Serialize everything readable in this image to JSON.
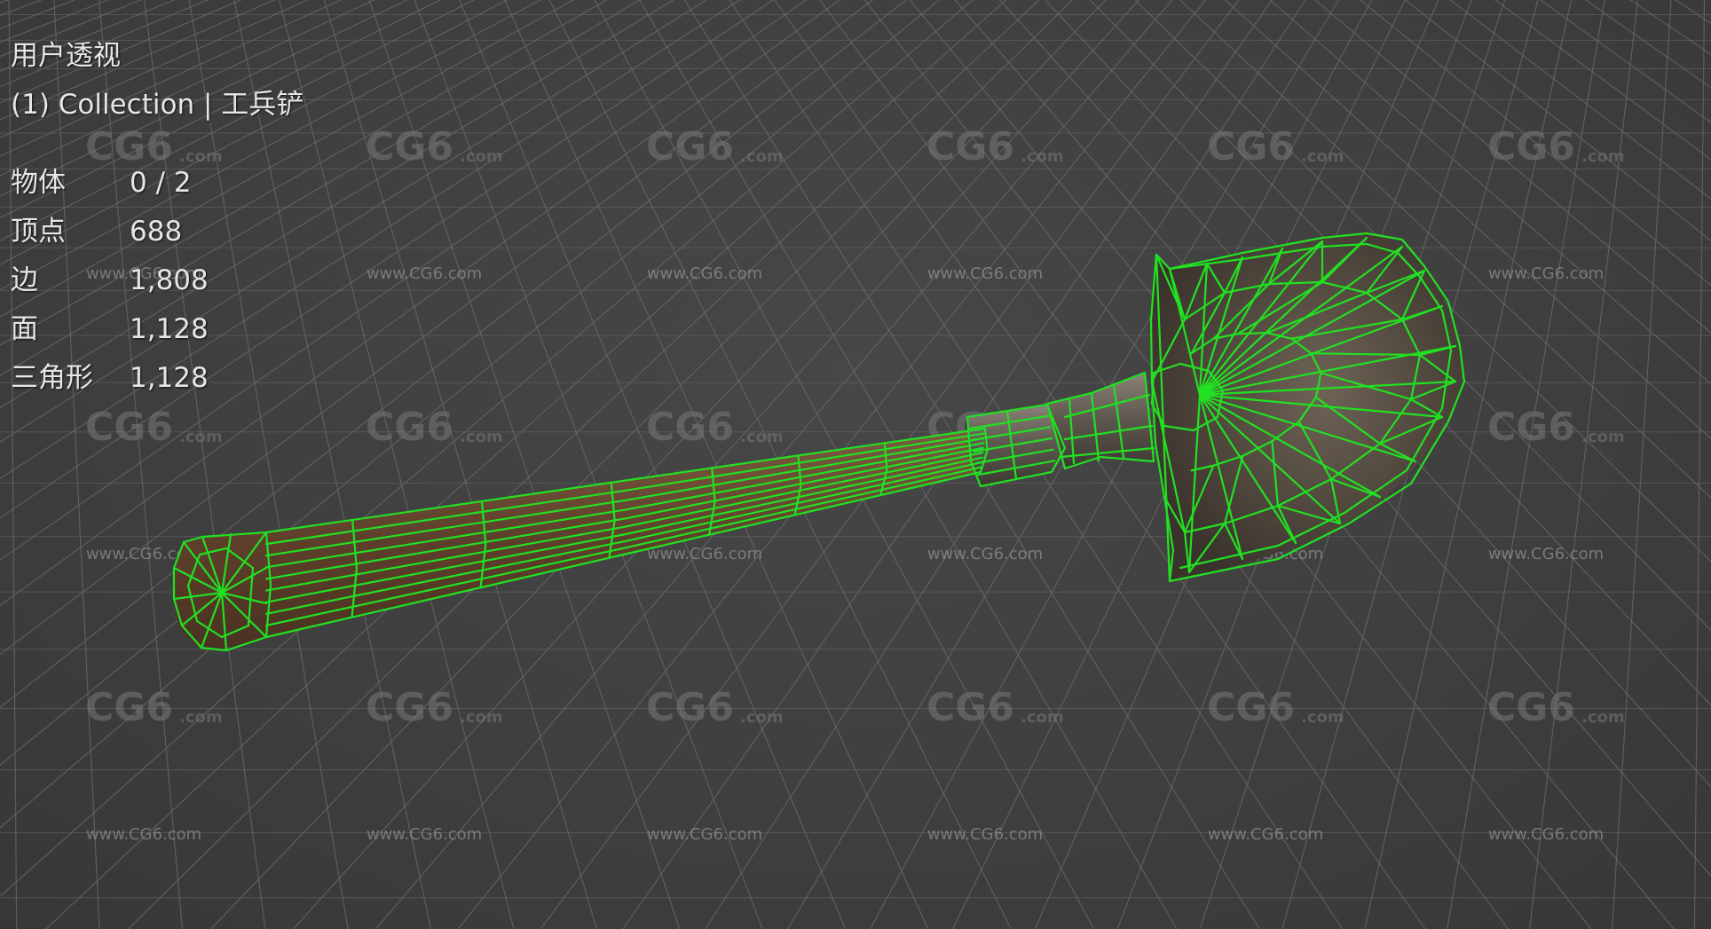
{
  "viewport": {
    "view_name": "用户透视",
    "collection_line": "(1) Collection | 工兵铲",
    "stats": [
      {
        "label": "物体",
        "value": "0 / 2"
      },
      {
        "label": "顶点",
        "value": "688"
      },
      {
        "label": "边",
        "value": "1,808"
      },
      {
        "label": "面",
        "value": "1,128"
      },
      {
        "label": "三角形",
        "value": "1,128"
      }
    ]
  },
  "watermark": {
    "logo_text": "CG6",
    "logo_suffix": ".com",
    "url_text": "www.CG6.com"
  },
  "colors": {
    "background": "#3d3d3d",
    "grid_line": "#6a6a6a",
    "wireframe": "#22e022",
    "overlay_text": "#e6e6e6",
    "shovel_metal": "#5a5046",
    "handle_wood": "#6b4a34"
  },
  "icons": {
    "object": "shovel-wireframe-model"
  }
}
